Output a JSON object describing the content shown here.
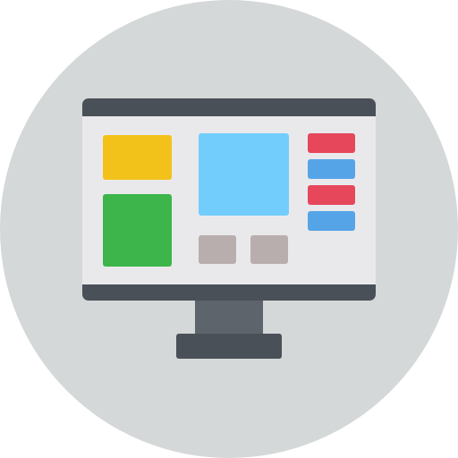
{
  "colors": {
    "background_circle": "#d5d8d8",
    "monitor_frame": "#4a5058",
    "screen": "#e9e9ec",
    "stand_neck": "#5d646b",
    "stand_base": "#4a5058",
    "tile_yellow": "#f2c21b",
    "tile_green": "#3db54a",
    "tile_preview": "#72cdfc",
    "small_button": "#b9aeae",
    "sidebar_red": "#e6475a",
    "sidebar_blue": "#56a4e8"
  },
  "icons": {
    "main": "desktop-monitor-icon"
  },
  "sidebar": {
    "items": [
      "red",
      "blue",
      "red",
      "blue"
    ]
  }
}
